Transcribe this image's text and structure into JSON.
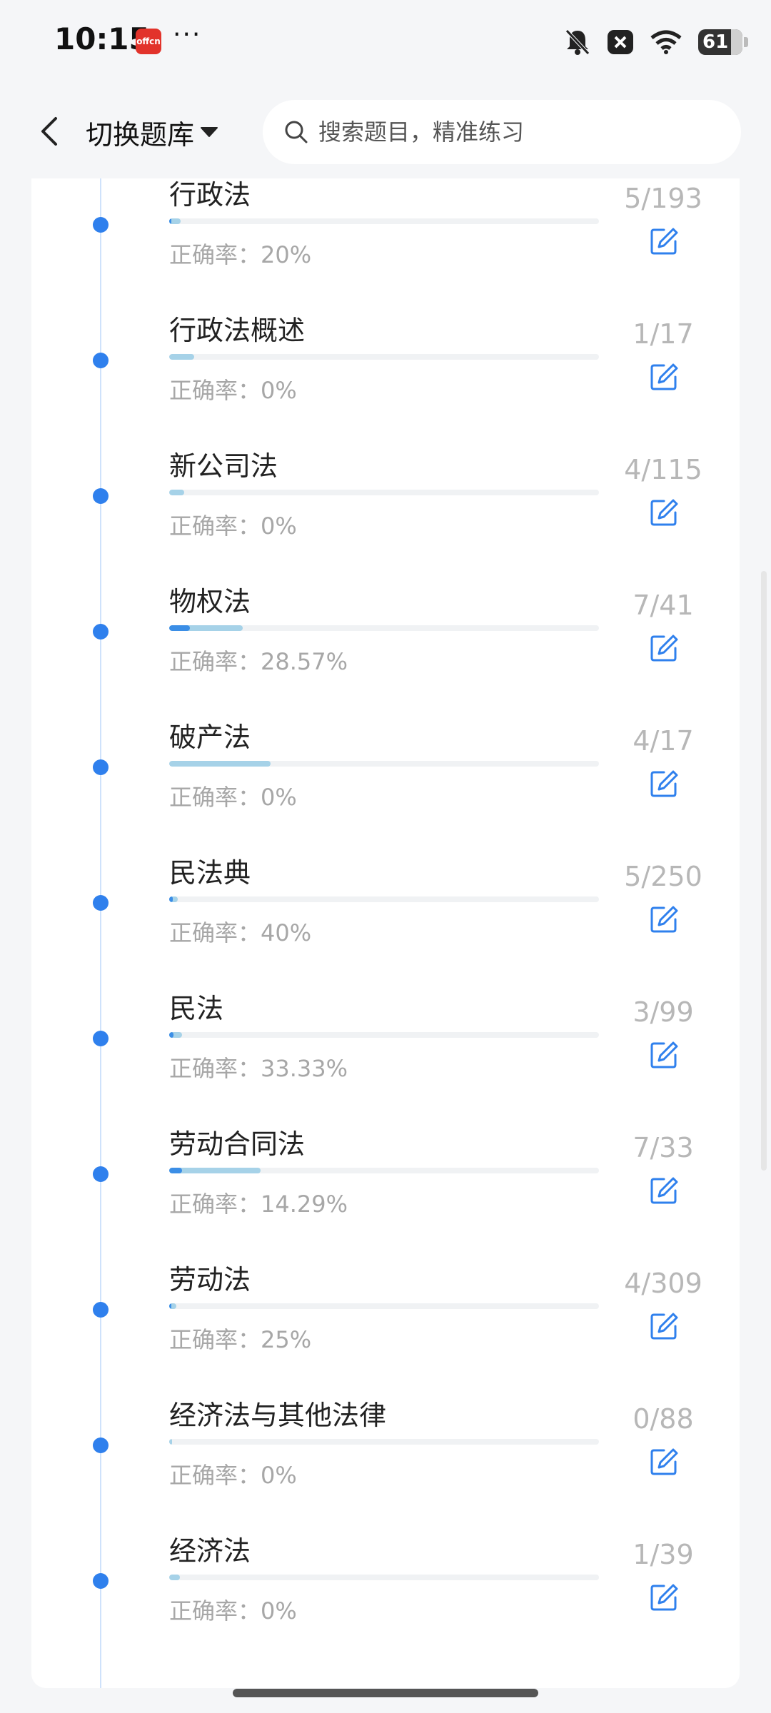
{
  "status_bar": {
    "time": "10:15",
    "app_badge": "offcn",
    "more": "···",
    "battery": "61",
    "icons": [
      "bell-off-icon",
      "close-box-icon",
      "wifi-icon",
      "battery-icon"
    ]
  },
  "header": {
    "switch_label": "切换题库",
    "search_placeholder": "搜索题目，精准练习"
  },
  "colors": {
    "accent": "#2f80ed",
    "progress_attempt": "#a6d2e8",
    "progress_correct": "#3b8ee6",
    "muted_text": "#a7a7a7"
  },
  "items": [
    {
      "title": "行政法",
      "accuracy_label": "正确率：",
      "accuracy": "20%",
      "count": "5/193",
      "done": 5,
      "total": 193,
      "rate": 0.2
    },
    {
      "title": "行政法概述",
      "accuracy_label": "正确率：",
      "accuracy": "0%",
      "count": "1/17",
      "done": 1,
      "total": 17,
      "rate": 0
    },
    {
      "title": "新公司法",
      "accuracy_label": "正确率：",
      "accuracy": "0%",
      "count": "4/115",
      "done": 4,
      "total": 115,
      "rate": 0
    },
    {
      "title": "物权法",
      "accuracy_label": "正确率：",
      "accuracy": "28.57%",
      "count": "7/41",
      "done": 7,
      "total": 41,
      "rate": 0.2857
    },
    {
      "title": "破产法",
      "accuracy_label": "正确率：",
      "accuracy": "0%",
      "count": "4/17",
      "done": 4,
      "total": 17,
      "rate": 0
    },
    {
      "title": "民法典",
      "accuracy_label": "正确率：",
      "accuracy": "40%",
      "count": "5/250",
      "done": 5,
      "total": 250,
      "rate": 0.4
    },
    {
      "title": "民法",
      "accuracy_label": "正确率：",
      "accuracy": "33.33%",
      "count": "3/99",
      "done": 3,
      "total": 99,
      "rate": 0.3333
    },
    {
      "title": "劳动合同法",
      "accuracy_label": "正确率：",
      "accuracy": "14.29%",
      "count": "7/33",
      "done": 7,
      "total": 33,
      "rate": 0.1429
    },
    {
      "title": "劳动法",
      "accuracy_label": "正确率：",
      "accuracy": "25%",
      "count": "4/309",
      "done": 4,
      "total": 309,
      "rate": 0.25
    },
    {
      "title": "经济法与其他法律",
      "accuracy_label": "正确率：",
      "accuracy": "0%",
      "count": "0/88",
      "done": 0,
      "total": 88,
      "rate": 0
    },
    {
      "title": "经济法",
      "accuracy_label": "正确率：",
      "accuracy": "0%",
      "count": "1/39",
      "done": 1,
      "total": 39,
      "rate": 0
    }
  ]
}
